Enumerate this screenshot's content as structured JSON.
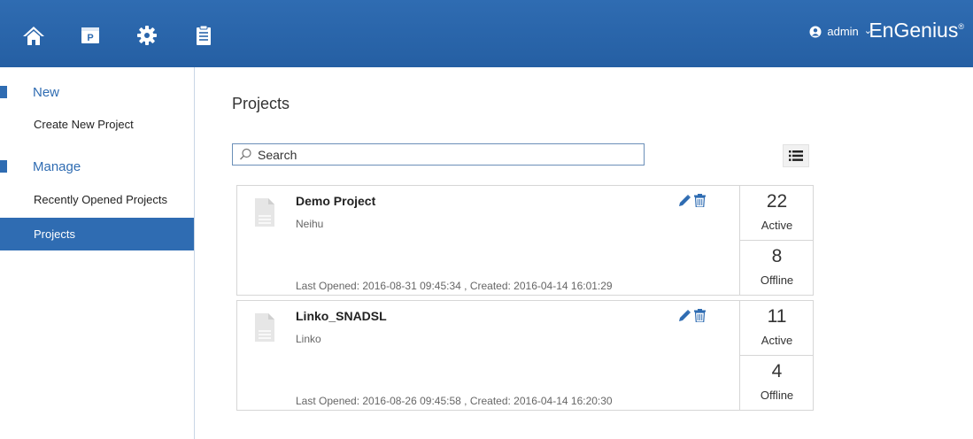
{
  "header": {
    "nav_icons": [
      "home-icon",
      "project-icon",
      "settings-icon",
      "clipboard-icon"
    ],
    "user_icon": "user-circle-icon",
    "username": "admin",
    "dropdown_caret": "⌄",
    "logo_text": "EnGenius",
    "logo_mark": "®",
    "colors": {
      "bar": "#2f6cb2"
    }
  },
  "sidebar": {
    "sections": [
      {
        "title": "New",
        "items": [
          "Create New Project"
        ]
      },
      {
        "title": "Manage",
        "items": [
          "Recently Opened Projects",
          "Projects"
        ]
      }
    ],
    "active_item": "Projects"
  },
  "main": {
    "title": "Projects",
    "search": {
      "placeholder": "Search",
      "value": ""
    },
    "view_toggle_icon": "list-view-icon",
    "projects": [
      {
        "name": "Demo Project",
        "location": "Neihu",
        "meta": "Last Opened: 2016-08-31 09:45:34 , Created: 2016-04-14 16:01:29",
        "active_count": "22",
        "active_label": "Active",
        "offline_count": "8",
        "offline_label": "Offline"
      },
      {
        "name": "Linko_SNADSL",
        "location": "Linko",
        "meta": "Last Opened: 2016-08-26 09:45:58 , Created: 2016-04-14 16:20:30",
        "active_count": "11",
        "active_label": "Active",
        "offline_count": "4",
        "offline_label": "Offline"
      }
    ]
  }
}
